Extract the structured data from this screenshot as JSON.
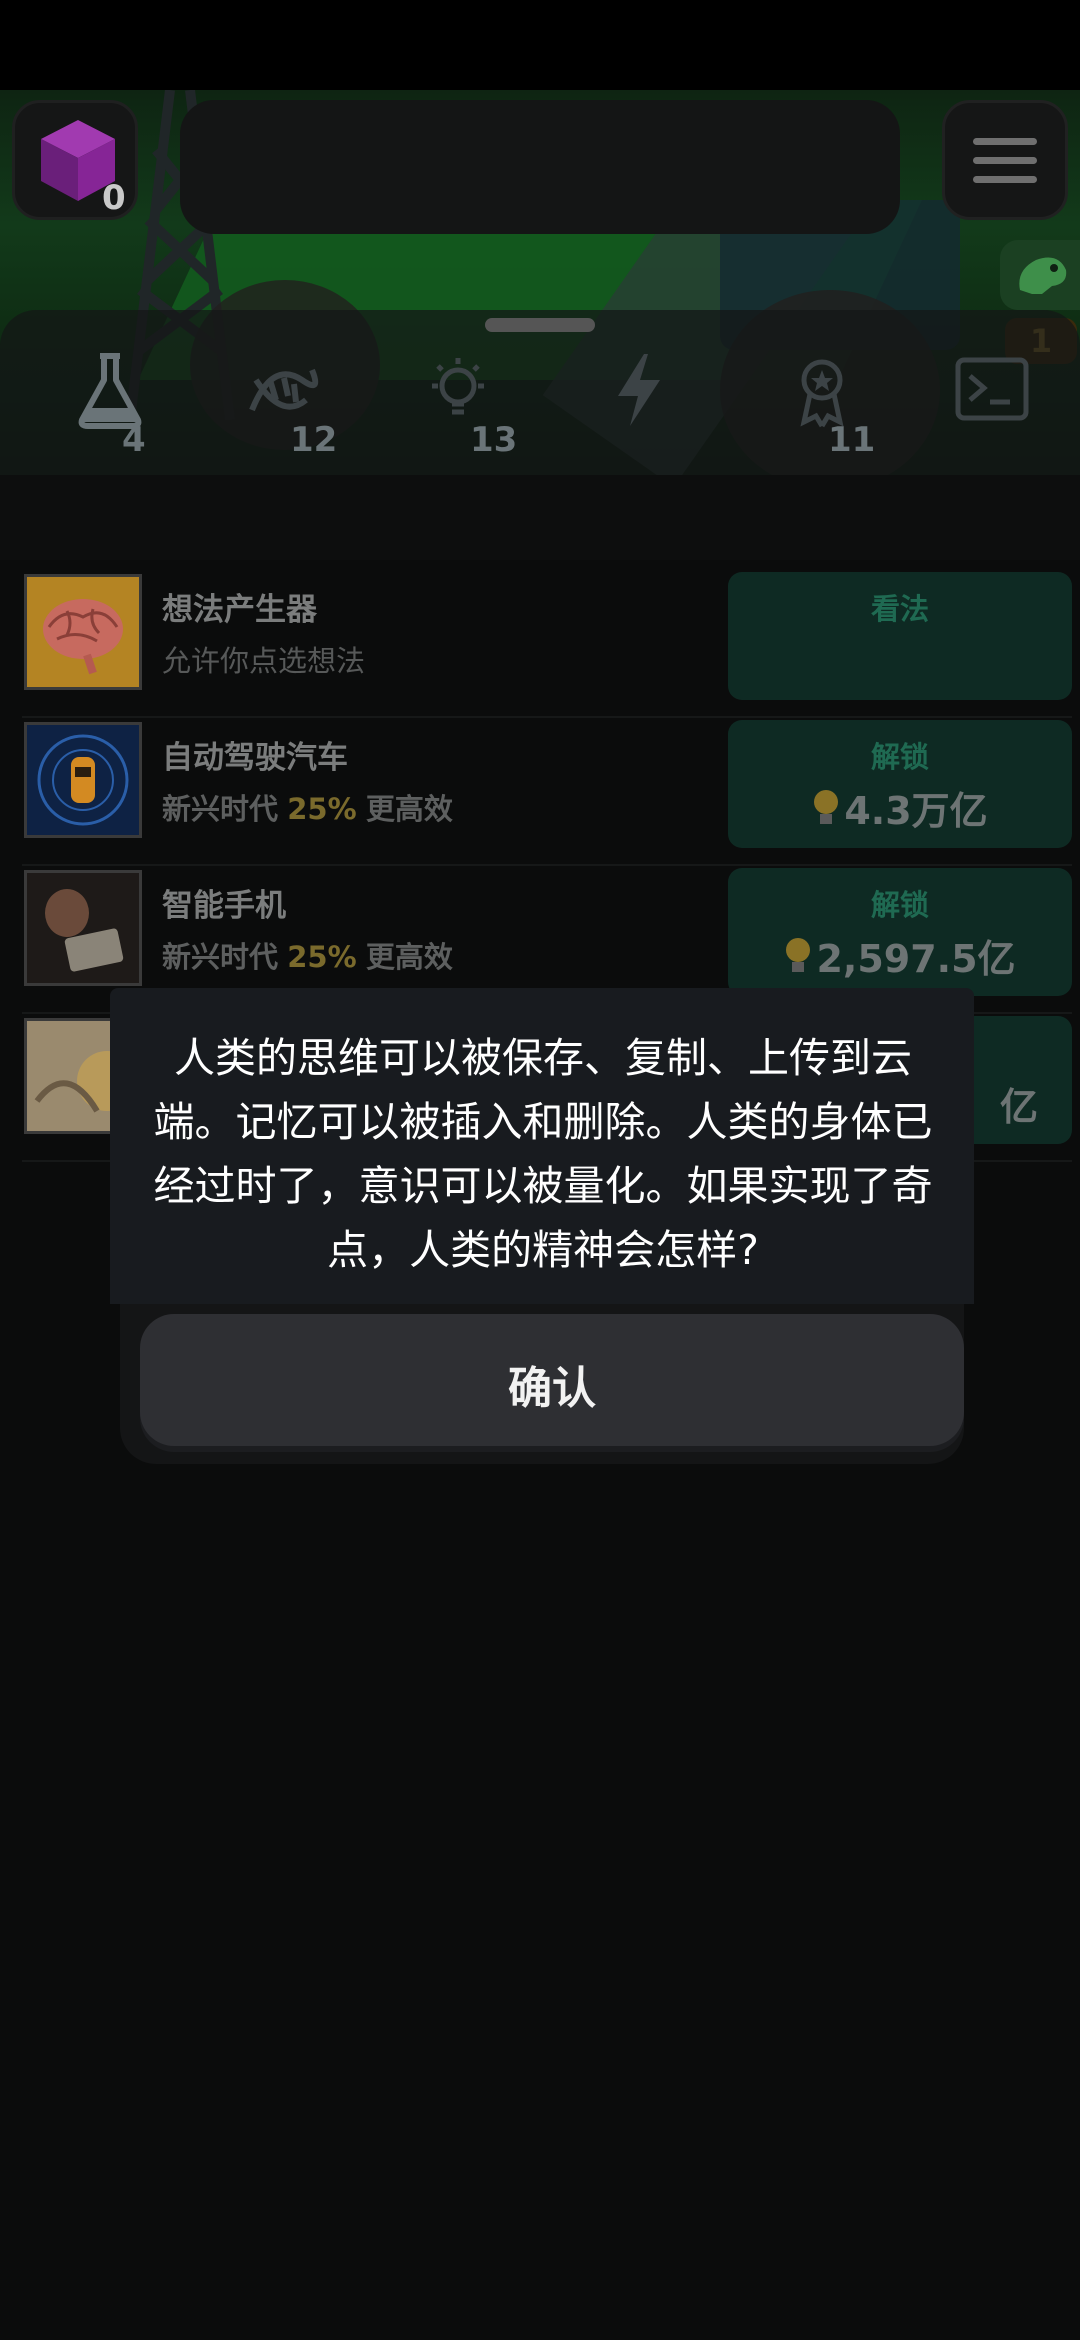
{
  "header": {
    "cube_count": "0"
  },
  "tabs": [
    {
      "name": "flask",
      "count": "4"
    },
    {
      "name": "dna",
      "count": "12"
    },
    {
      "name": "lightbulb",
      "count": "13"
    },
    {
      "name": "lightning",
      "count": ""
    },
    {
      "name": "award",
      "count": "11"
    },
    {
      "name": "terminal",
      "count": ""
    }
  ],
  "side_badge": "1",
  "research": [
    {
      "title": "想法产生器",
      "subtitle": "允许你点选想法",
      "button_label": "看法",
      "cost": ""
    },
    {
      "title": "自动驾驶汽车",
      "era": "新兴时代",
      "boost": "25%",
      "effect": "更高效",
      "button_label": "解锁",
      "cost": "4.3万亿"
    },
    {
      "title": "智能手机",
      "era": "新兴时代",
      "boost": "25%",
      "effect": "更高效",
      "button_label": "解锁",
      "cost": "2,597.5亿"
    },
    {
      "title": "",
      "button_label": "",
      "cost": "亿"
    }
  ],
  "dialog": {
    "message": "人类的思维可以被保存、复制、上传到云端。记忆可以被插入和删除。人类的身体已经过时了，意识可以被量化。如果实现了奇点，人类的精神会怎样?",
    "confirm_label": "确认"
  },
  "colors": {
    "accent_green": "#1f6a52",
    "gold": "#7a6a2c",
    "dialog_bg": "#181b1f"
  }
}
